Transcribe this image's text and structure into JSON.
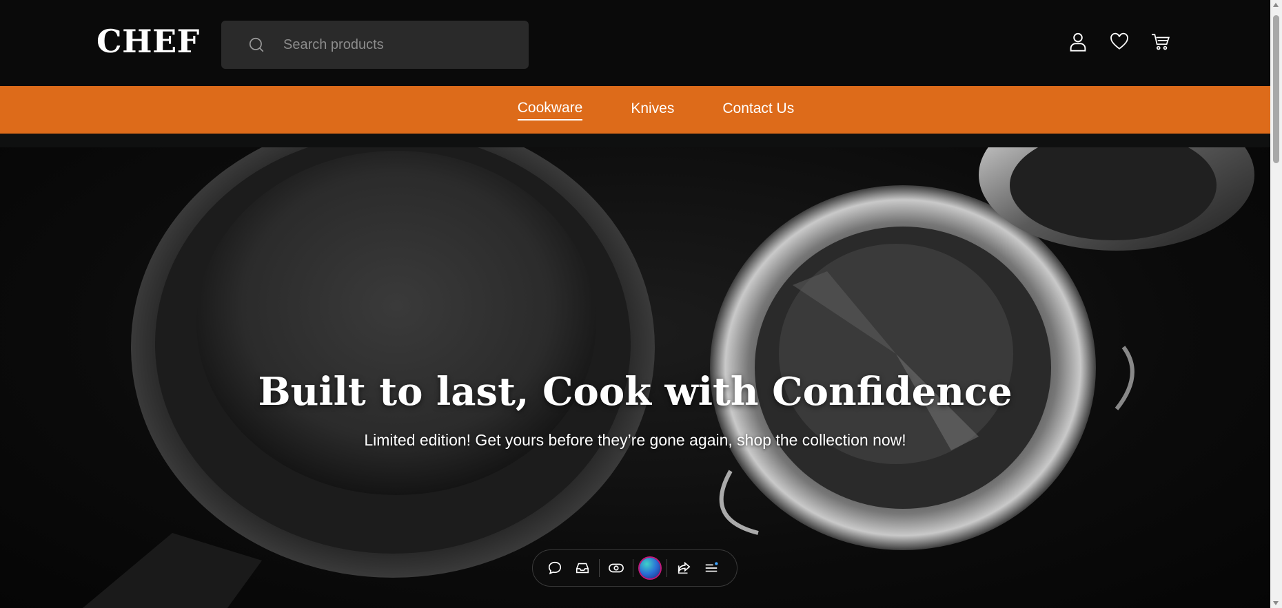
{
  "header": {
    "logo": "CHEF",
    "search": {
      "placeholder": "Search products",
      "icon": "search-icon"
    },
    "icons": [
      "user-icon",
      "heart-icon",
      "cart-icon"
    ]
  },
  "nav": {
    "items": [
      {
        "label": "Cookware",
        "active": true
      },
      {
        "label": "Knives",
        "active": false
      },
      {
        "label": "Contact Us",
        "active": false
      }
    ]
  },
  "hero": {
    "title": "Built to last, Cook with Confidence",
    "subtitle": "Limited edition! Get yours before they’re gone again, shop the collection now!"
  },
  "toolbar": {
    "icons": [
      "comment-icon",
      "inbox-icon",
      "eye-icon",
      "avatar-orb",
      "share-icon",
      "menu-icon"
    ]
  },
  "colors": {
    "accent": "#dd6b1a",
    "header_bg": "#0a0a0a",
    "search_bg": "#2a2a2a"
  }
}
